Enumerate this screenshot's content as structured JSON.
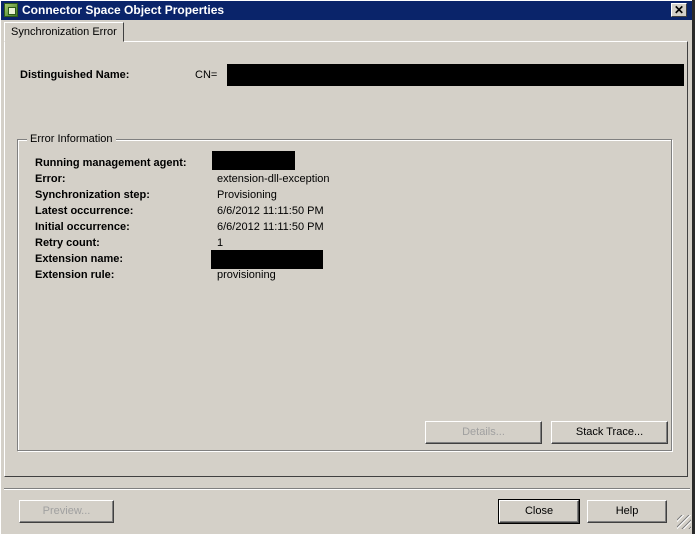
{
  "window": {
    "title": "Connector Space Object Properties",
    "close_glyph": "✕"
  },
  "tab": {
    "label": "Synchronization Error"
  },
  "distinguished_name": {
    "label": "Distinguished Name:",
    "value_visible": "CN="
  },
  "error_information": {
    "group_title": "Error Information",
    "rows": [
      {
        "label": "Running management agent:",
        "value": ""
      },
      {
        "label": "Error:",
        "value": "extension-dll-exception"
      },
      {
        "label": "Synchronization step:",
        "value": "Provisioning"
      },
      {
        "label": "Latest occurrence:",
        "value": "6/6/2012 11:11:50 PM"
      },
      {
        "label": "Initial occurrence:",
        "value": "6/6/2012 11:11:50 PM"
      },
      {
        "label": "Retry count:",
        "value": "1"
      },
      {
        "label": "Extension name:",
        "value": ""
      },
      {
        "label": "Extension rule:",
        "value": "provisioning"
      }
    ],
    "buttons": {
      "details": "Details...",
      "stack_trace": "Stack Trace..."
    }
  },
  "footer": {
    "preview": "Preview...",
    "close": "Close",
    "help": "Help"
  },
  "icons": {
    "app": "connector-app-icon",
    "close": "close-icon",
    "grip": "resize-grip-icon"
  }
}
